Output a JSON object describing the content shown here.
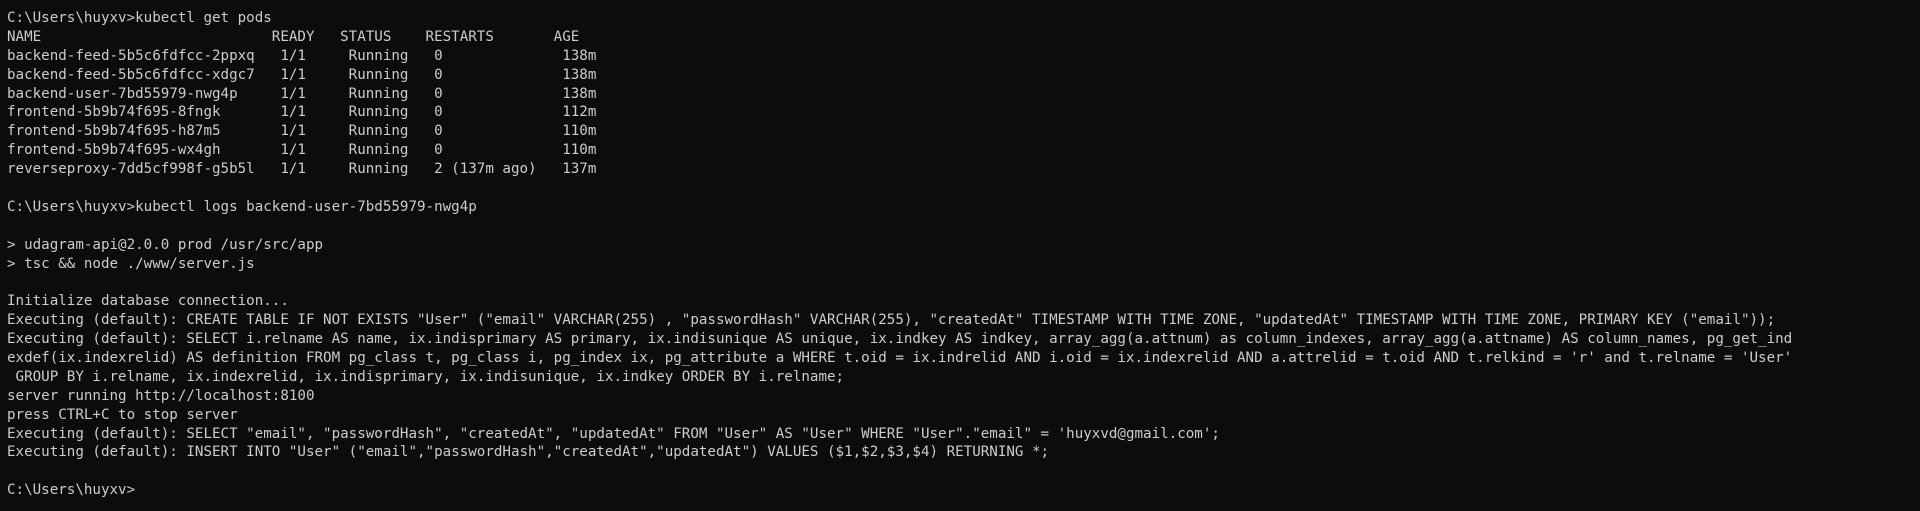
{
  "terminal": {
    "lines": [
      "C:\\Users\\huyxv>kubectl get pods",
      "NAME                           READY   STATUS    RESTARTS       AGE",
      "backend-feed-5b5c6fdfcc-2ppxq   1/1     Running   0              138m",
      "backend-feed-5b5c6fdfcc-xdgc7   1/1     Running   0              138m",
      "backend-user-7bd55979-nwg4p     1/1     Running   0              138m",
      "frontend-5b9b74f695-8fngk       1/1     Running   0              112m",
      "frontend-5b9b74f695-h87m5       1/1     Running   0              110m",
      "frontend-5b9b74f695-wx4gh       1/1     Running   0              110m",
      "reverseproxy-7dd5cf998f-g5b5l   1/1     Running   2 (137m ago)   137m",
      "",
      "C:\\Users\\huyxv>kubectl logs backend-user-7bd55979-nwg4p",
      "",
      "> udagram-api@2.0.0 prod /usr/src/app",
      "> tsc && node ./www/server.js",
      "",
      "Initialize database connection...",
      "Executing (default): CREATE TABLE IF NOT EXISTS \"User\" (\"email\" VARCHAR(255) , \"passwordHash\" VARCHAR(255), \"createdAt\" TIMESTAMP WITH TIME ZONE, \"updatedAt\" TIMESTAMP WITH TIME ZONE, PRIMARY KEY (\"email\"));",
      "Executing (default): SELECT i.relname AS name, ix.indisprimary AS primary, ix.indisunique AS unique, ix.indkey AS indkey, array_agg(a.attnum) as column_indexes, array_agg(a.attname) AS column_names, pg_get_ind",
      "exdef(ix.indexrelid) AS definition FROM pg_class t, pg_class i, pg_index ix, pg_attribute a WHERE t.oid = ix.indrelid AND i.oid = ix.indexrelid AND a.attrelid = t.oid AND t.relkind = 'r' and t.relname = 'User'",
      " GROUP BY i.relname, ix.indexrelid, ix.indisprimary, ix.indisunique, ix.indkey ORDER BY i.relname;",
      "server running http://localhost:8100",
      "press CTRL+C to stop server",
      "Executing (default): SELECT \"email\", \"passwordHash\", \"createdAt\", \"updatedAt\" FROM \"User\" AS \"User\" WHERE \"User\".\"email\" = 'huyxvd@gmail.com';",
      "Executing (default): INSERT INTO \"User\" (\"email\",\"passwordHash\",\"createdAt\",\"updatedAt\") VALUES ($1,$2,$3,$4) RETURNING *;",
      "",
      "C:\\Users\\huyxv>"
    ]
  }
}
